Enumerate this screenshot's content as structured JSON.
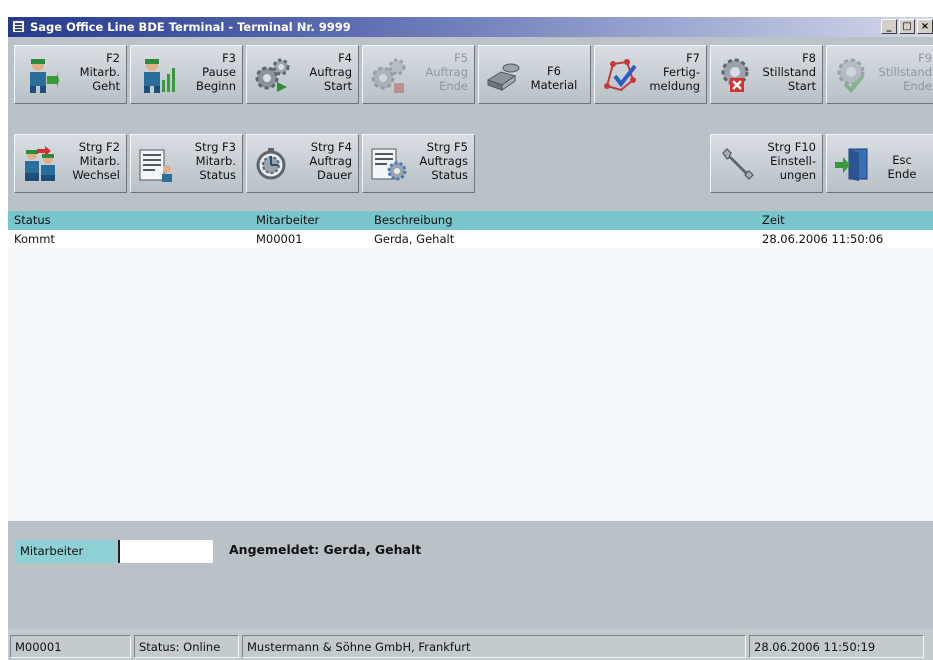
{
  "window": {
    "title": "Sage Office Line BDE Terminal - Terminal Nr. 9999"
  },
  "toolbar_row1": [
    {
      "lines": [
        "F2",
        "Mitarb.",
        "Geht"
      ],
      "icon": "worker-leave-icon",
      "enabled": true
    },
    {
      "lines": [
        "F3",
        "Pause",
        "Beginn"
      ],
      "icon": "worker-pause-icon",
      "enabled": true
    },
    {
      "lines": [
        "F4",
        "Auftrag",
        "Start"
      ],
      "icon": "gears-start-icon",
      "enabled": true
    },
    {
      "lines": [
        "F5",
        "Auftrag",
        "Ende"
      ],
      "icon": "gears-stop-icon",
      "enabled": false
    },
    {
      "lines": [
        "F6",
        "Material"
      ],
      "icon": "material-icon",
      "enabled": true
    },
    {
      "lines": [
        "F7",
        "Fertig-",
        "meldung"
      ],
      "icon": "completion-icon",
      "enabled": true
    },
    {
      "lines": [
        "F8",
        "Stillstand",
        "Start"
      ],
      "icon": "downtime-start-icon",
      "enabled": true
    },
    {
      "lines": [
        "F9",
        "Stillstand",
        "Ende"
      ],
      "icon": "downtime-end-icon",
      "enabled": false
    }
  ],
  "toolbar_row2": [
    {
      "lines": [
        "Strg F2",
        "Mitarb.",
        "Wechsel"
      ],
      "icon": "worker-change-icon",
      "enabled": true
    },
    {
      "lines": [
        "Strg F3",
        "Mitarb.",
        "Status"
      ],
      "icon": "worker-status-icon",
      "enabled": true
    },
    {
      "lines": [
        "Strg F4",
        "Auftrag",
        "Dauer"
      ],
      "icon": "order-duration-icon",
      "enabled": true
    },
    {
      "lines": [
        "Strg F5",
        "Auftrags",
        "Status"
      ],
      "icon": "order-status-icon",
      "enabled": true
    },
    {
      "lines": [
        "Strg F10",
        "Einstell-",
        "ungen"
      ],
      "icon": "wrench-icon",
      "enabled": true
    },
    {
      "lines": [
        "Esc",
        "Ende"
      ],
      "icon": "exit-door-icon",
      "enabled": true
    }
  ],
  "grid": {
    "columns": [
      "Status",
      "Mitarbeiter",
      "Beschreibung",
      "Zeit"
    ],
    "rows": [
      [
        "Kommt",
        "M00001",
        "Gerda, Gehalt",
        "28.06.2006 11:50:06"
      ]
    ]
  },
  "employee": {
    "label": "Mitarbeiter",
    "value": "",
    "logged_in": "Angemeldet: Gerda, Gehalt"
  },
  "statusbar": {
    "user": "M00001",
    "status": "Status: Online",
    "company": "Mustermann & Söhne GmbH, Frankfurt",
    "datetime": "28.06.2006 11:50:19"
  },
  "colors": {
    "title_gradient": [
      "#25398f",
      "#d3d8ea"
    ],
    "grid_header": "#78c6cc",
    "window_bg": "#b9c2c7"
  }
}
